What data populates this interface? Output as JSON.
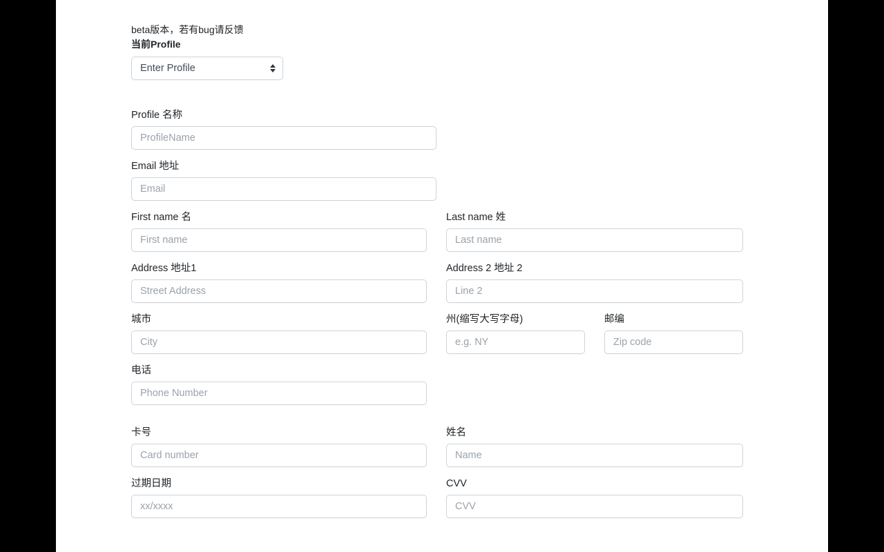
{
  "header": {
    "beta_note": "beta版本，若有bug请反馈",
    "current_profile_label": "当前Profile"
  },
  "profile_select": {
    "selected": "Enter Profile",
    "icon": "chevron-updown-icon"
  },
  "form": {
    "profile_name": {
      "label": "Profile 名称",
      "placeholder": "ProfileName",
      "value": ""
    },
    "email": {
      "label": "Email 地址",
      "placeholder": "Email",
      "value": ""
    },
    "first_name": {
      "label": "First name 名",
      "placeholder": "First name",
      "value": ""
    },
    "last_name": {
      "label": "Last name 姓",
      "placeholder": "Last name",
      "value": ""
    },
    "address1": {
      "label": "Address 地址1",
      "placeholder": "Street Address",
      "value": ""
    },
    "address2": {
      "label": "Address 2 地址 2",
      "placeholder": "Line 2",
      "value": ""
    },
    "city": {
      "label": "城市",
      "placeholder": "City",
      "value": ""
    },
    "state": {
      "label": "州(缩写大写字母)",
      "placeholder": "e.g. NY",
      "value": ""
    },
    "zip": {
      "label": "邮编",
      "placeholder": "Zip code",
      "value": ""
    },
    "phone": {
      "label": "电话",
      "placeholder": "Phone Number",
      "value": ""
    },
    "card_number": {
      "label": "卡号",
      "placeholder": "Card number",
      "value": ""
    },
    "card_name": {
      "label": "姓名",
      "placeholder": "Name",
      "value": ""
    },
    "expiry": {
      "label": "过期日期",
      "placeholder": "xx/xxxx",
      "value": ""
    },
    "cvv": {
      "label": "CVV",
      "placeholder": "CVV",
      "value": ""
    }
  },
  "colors": {
    "letterbox": "#000000",
    "page_background": "#ffffff",
    "input_border": "#ced4da",
    "label_text": "#212529",
    "placeholder_text": "#9aa2ab"
  }
}
